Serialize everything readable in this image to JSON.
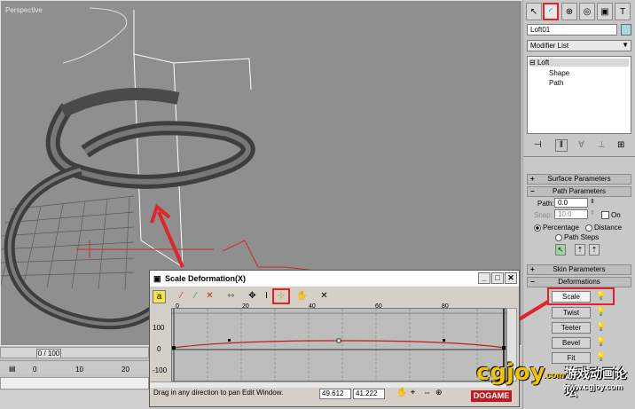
{
  "viewport": {
    "label": "Perspective"
  },
  "timeline": {
    "frame_label": "0 / 100",
    "ticks": [
      "0",
      "10",
      "20"
    ]
  },
  "panel": {
    "tabs": [
      "create-icon",
      "modify-icon",
      "hierarchy-icon",
      "motion-icon",
      "display-icon",
      "utilities-icon"
    ],
    "object_name": "Loft01",
    "modifier_list": "Modifier List",
    "stack": [
      "Loft",
      "Shape",
      "Path"
    ],
    "surface_parameters": "Surface Parameters",
    "path_parameters": "Path Parameters",
    "path_label": "Path:",
    "path_value": "0.0",
    "snap_label": "Snap:",
    "snap_value": "10.0",
    "on_label": "On",
    "percentage_label": "Percentage",
    "distance_label": "Distance",
    "path_steps_label": "Path Steps",
    "skin_parameters": "Skin Parameters",
    "deformations": "Deformations",
    "deform_buttons": [
      "Scale",
      "Twist",
      "Teeter",
      "Bevel",
      "Fit"
    ]
  },
  "dialog": {
    "title": "Scale Deformation(X)",
    "ruler": [
      "0",
      "20",
      "40",
      "60",
      "80"
    ],
    "yaxis": [
      "100",
      "0",
      "-100"
    ],
    "status": "Drag in any direction to pan Edit Window.",
    "coord_x": "49.612",
    "coord_y": "41.222"
  },
  "logo": {
    "brand": "cgjoy",
    "domain": ".com",
    "cn_title": "游戏动画论坛",
    "url": "www.cgjoy.com",
    "badge": "DOGAME"
  },
  "colors": {
    "accent_red": "#e0242a",
    "curve": "#b52020"
  }
}
